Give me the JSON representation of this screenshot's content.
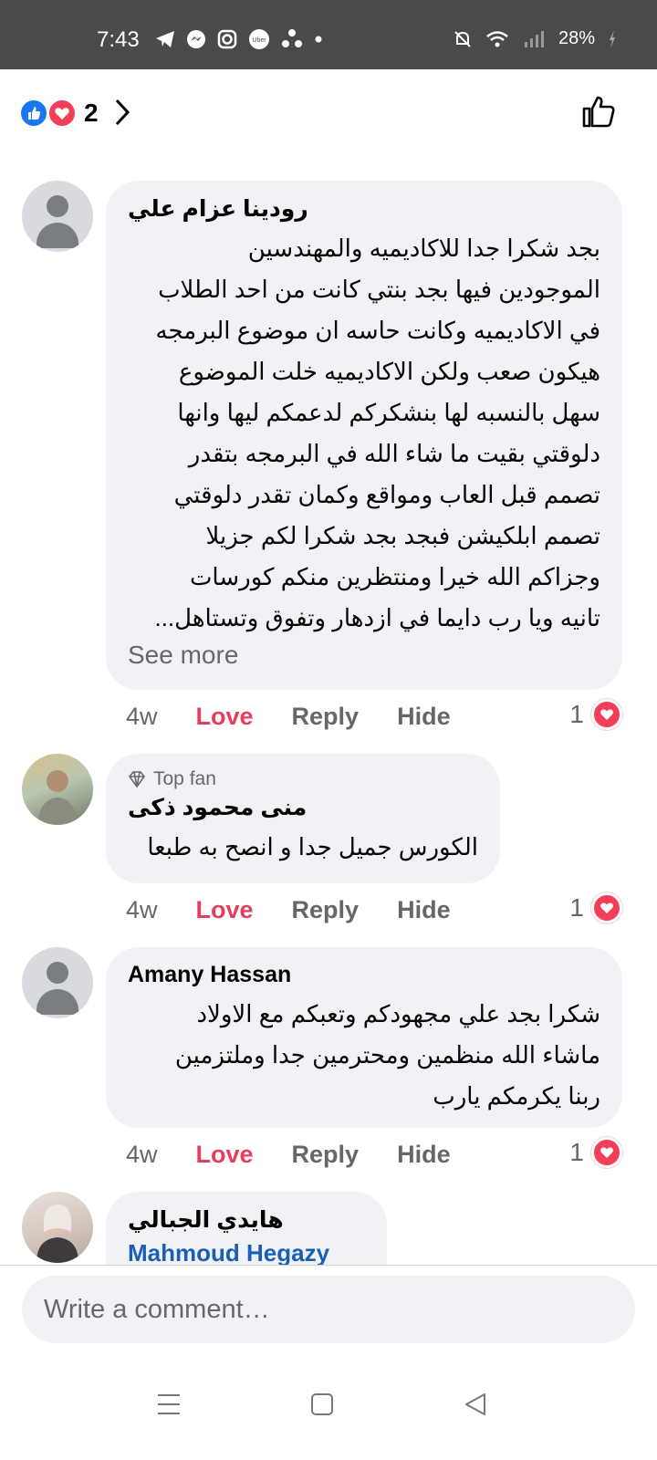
{
  "status_bar": {
    "time": "7:43",
    "battery": "28%",
    "icons": [
      "telegram-icon",
      "messenger-icon",
      "instagram-icon",
      "uber-icon",
      "app-icon",
      "dot-icon",
      "mute-icon",
      "wifi-icon",
      "signal-icon",
      "charging-icon"
    ]
  },
  "reactions": {
    "count": "2"
  },
  "comments": [
    {
      "author": "رودينا عزام علي",
      "text": "بجد شكرا جدا للاكاديميه والمهندسين\nالموجودين فيها بجد بنتي كانت من احد الطلاب\nفي الاكاديميه وكانت حاسه ان موضوع البرمجه\nهيكون صعب ولكن الاكاديميه خلت الموضوع\nسهل بالنسبه لها  بنشكركم لدعمكم ليها وانها\nدلوقتي بقيت ما شاء الله في البرمجه بتقدر\nتصمم قبل العاب ومواقع وكمان  تقدر دلوقتي\nتصمم ابلكيشن فبجد بجد شكرا لكم جزيلا\nوجزاكم الله خيرا ومنتظرين منكم كورسات\nتانيه ويا رب دايما في ازدهار وتفوق وتستاهل...",
      "see_more": "See more",
      "age": "4w",
      "love": "Love",
      "reply": "Reply",
      "hide": "Hide",
      "reaction_count": "1"
    },
    {
      "badge": "Top fan",
      "author": "منى محمود ذكى",
      "text": "الكورس جميل جدا و انصح به طبعا",
      "age": "4w",
      "love": "Love",
      "reply": "Reply",
      "hide": "Hide",
      "reaction_count": "1"
    },
    {
      "author": "Amany Hassan",
      "text": "شكرا بجد علي مجهودكم وتعبكم مع الاولاد\nماشاء الله منظمين ومحترمين جدا وملتزمين\nربنا يكرمكم يارب",
      "age": "4w",
      "love": "Love",
      "reply": "Reply",
      "hide": "Hide",
      "reaction_count": "1"
    },
    {
      "author": "هايدي الجبالي",
      "mention": "Mahmoud Hegazy"
    }
  ],
  "composer": {
    "placeholder": "Write a comment…"
  },
  "colors": {
    "love": "#e4405e",
    "like": "#1877f2",
    "bubble": "#f0f2f5",
    "mention": "#1a5fb4"
  }
}
